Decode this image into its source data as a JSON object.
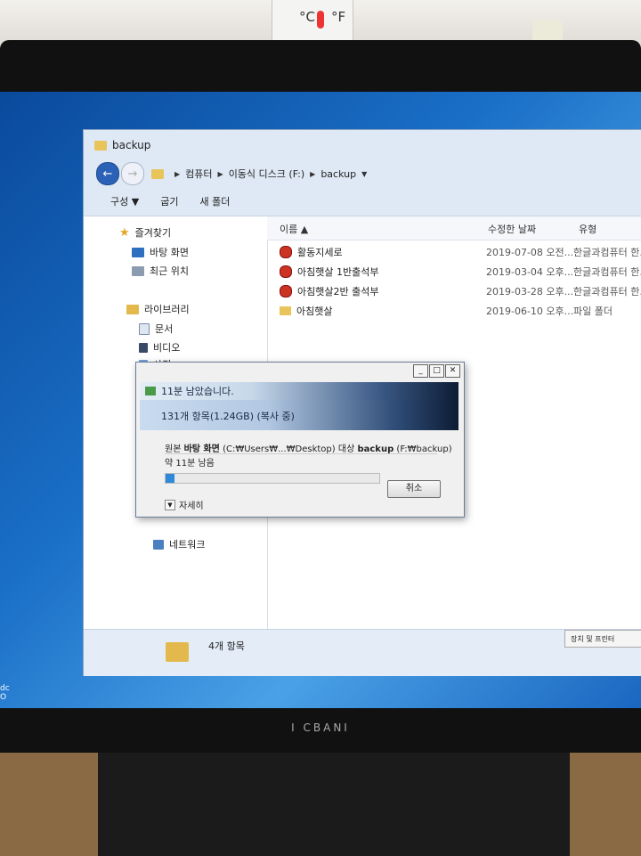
{
  "explorer": {
    "title": "backup",
    "breadcrumb": [
      "컴퓨터",
      "이동식 디스크 (F:)",
      "backup"
    ],
    "toolbar": [
      "구성 ▼",
      "굽기",
      "새 폴더"
    ],
    "columns": {
      "name": "이름",
      "date": "수정한 날짜",
      "type": "유형"
    },
    "files": [
      {
        "name": "활동지세로",
        "date": "2019-07-08 오전...",
        "type": "한글과컴퓨터 한...",
        "kind": "hwp"
      },
      {
        "name": "아침햇살 1반출석부",
        "date": "2019-03-04 오후...",
        "type": "한글과컴퓨터 한...",
        "kind": "hwp"
      },
      {
        "name": "아침햇살2반 출석부",
        "date": "2019-03-28 오후...",
        "type": "한글과컴퓨터 한...",
        "kind": "hwp"
      },
      {
        "name": "아침햇살",
        "date": "2019-06-10 오후...",
        "type": "파일 폴더",
        "kind": "folder"
      }
    ],
    "nav": {
      "favorites": "즐겨찾기",
      "desktop": "바탕 화면",
      "recent": "최근 위치",
      "libraries": "라이브러리",
      "documents": "문서",
      "videos": "비디오",
      "pictures": "사진",
      "network": "네트워크"
    },
    "status": {
      "count": "4개 항목",
      "tray": "장치 및 프린터"
    }
  },
  "copy_dialog": {
    "title": "11분 남았습니다.",
    "items": "131개 항목(1.24GB) (복사 중)",
    "source_prefix": "원본",
    "source_name": "바탕 화면",
    "source_path": "(C:₩Users₩...₩Desktop)",
    "dest_prefix": "대상",
    "dest_name": "backup",
    "dest_path": "(F:₩backup)",
    "remaining": "약 11분 남음",
    "progress": 0.04,
    "cancel": "취소",
    "details": "자세히"
  },
  "room": {
    "thermo_c": "°C",
    "thermo_f": "°F",
    "brand": "I CBANI"
  }
}
